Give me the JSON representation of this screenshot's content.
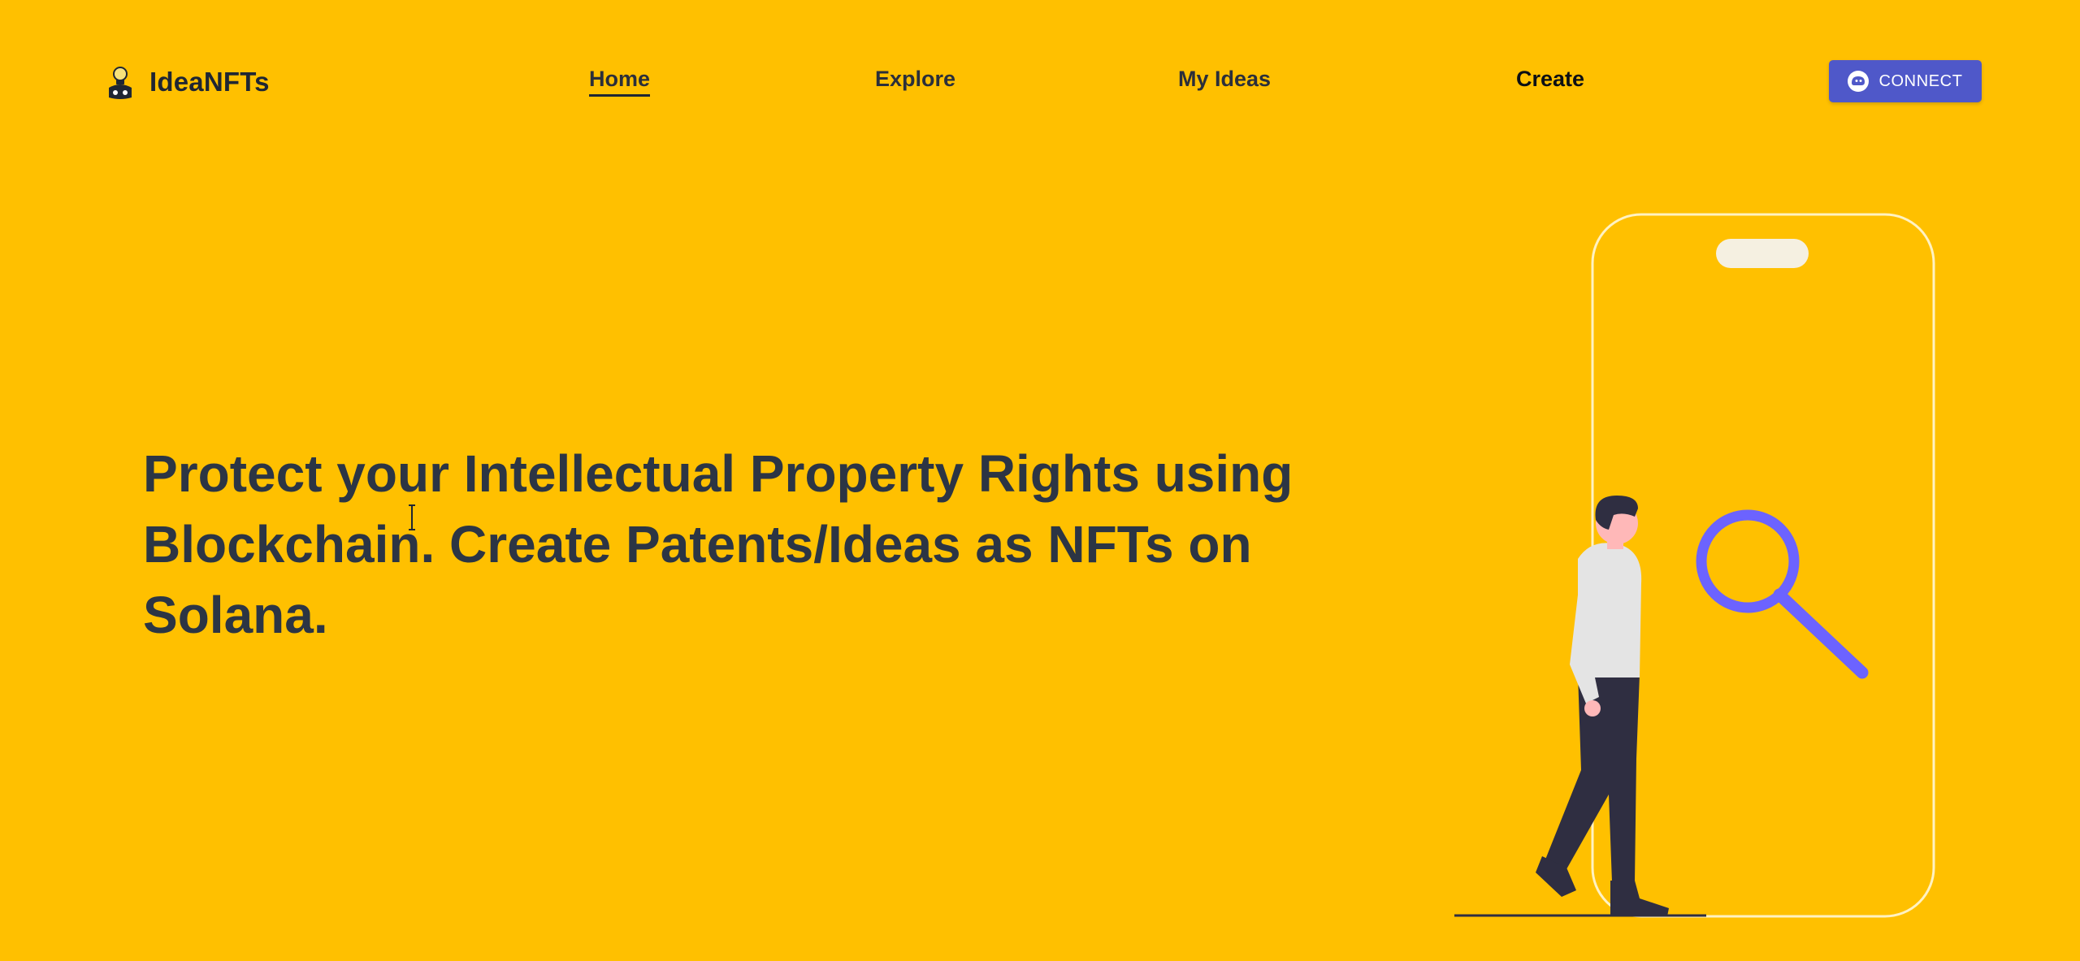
{
  "brand": {
    "name": "IdeaNFTs",
    "logo_icon": "lightbulb-ideas-icon"
  },
  "nav": {
    "items": [
      {
        "label": "Home",
        "active": true
      },
      {
        "label": "Explore",
        "active": false
      },
      {
        "label": "My Ideas",
        "active": false
      },
      {
        "label": "Create",
        "active": false
      }
    ]
  },
  "connect_button": {
    "label": "CONNECT",
    "icon": "wallet-ghost-icon",
    "color": "#4f58c9"
  },
  "hero": {
    "heading": "Protect your Intellectual Property Rights using Blockchain. Create Patents/Ideas as NFTs on Solana."
  },
  "illustration": {
    "name": "person-with-phone-and-magnifier-illustration",
    "accent_color": "#6c63ff"
  },
  "colors": {
    "background": "#FFC000",
    "heading_text": "#2c3544",
    "nav_text": "#2b2f3a"
  }
}
